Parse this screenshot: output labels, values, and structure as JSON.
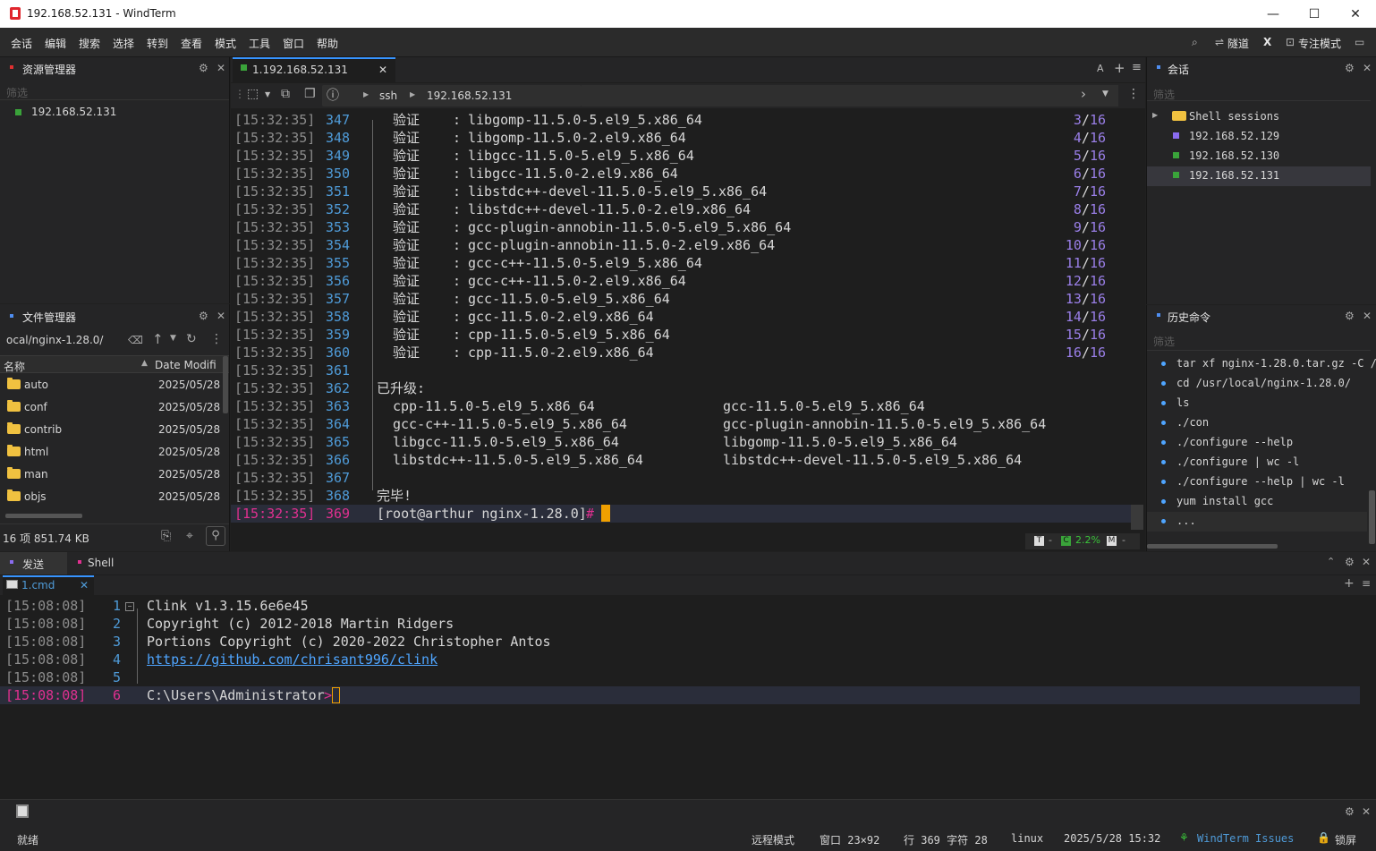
{
  "window": {
    "title": "192.168.52.131 - WindTerm",
    "minimize": "—",
    "maximize": "☐",
    "close": "✕"
  },
  "menu": [
    "会话",
    "编辑",
    "搜索",
    "选择",
    "转到",
    "查看",
    "模式",
    "工具",
    "窗口",
    "帮助"
  ],
  "toolbar_right": {
    "tunnel": "隧道",
    "x": "X",
    "focus": "专注模式"
  },
  "explorer": {
    "title": "资源管理器",
    "filter": "筛选",
    "item": "192.168.52.131"
  },
  "filemgr": {
    "title": "文件管理器",
    "path": "ocal/nginx-1.28.0/",
    "col_name": "名称",
    "col_date": "Date Modifi",
    "files": [
      {
        "name": "auto",
        "date": "2025/05/28"
      },
      {
        "name": "conf",
        "date": "2025/05/28"
      },
      {
        "name": "contrib",
        "date": "2025/05/28"
      },
      {
        "name": "html",
        "date": "2025/05/28"
      },
      {
        "name": "man",
        "date": "2025/05/28"
      },
      {
        "name": "objs",
        "date": "2025/05/28"
      }
    ],
    "footer": "16 项 851.74 KB"
  },
  "main_tab": {
    "label": "1.192.168.52.131",
    "close": "✕",
    "font_btn": "A",
    "add": "+",
    "more": "≡"
  },
  "addressbar": {
    "protocol": "ssh",
    "host": "192.168.52.131"
  },
  "terminal": {
    "verify": [
      {
        "ts": "[15:32:35]",
        "ln": "347",
        "pkg": "libgomp-11.5.0-5.el9_5.x86_64",
        "n": "3",
        "d": "16"
      },
      {
        "ts": "[15:32:35]",
        "ln": "348",
        "pkg": "libgomp-11.5.0-2.el9.x86_64",
        "n": "4",
        "d": "16"
      },
      {
        "ts": "[15:32:35]",
        "ln": "349",
        "pkg": "libgcc-11.5.0-5.el9_5.x86_64",
        "n": "5",
        "d": "16"
      },
      {
        "ts": "[15:32:35]",
        "ln": "350",
        "pkg": "libgcc-11.5.0-2.el9.x86_64",
        "n": "6",
        "d": "16"
      },
      {
        "ts": "[15:32:35]",
        "ln": "351",
        "pkg": "libstdc++-devel-11.5.0-5.el9_5.x86_64",
        "n": "7",
        "d": "16"
      },
      {
        "ts": "[15:32:35]",
        "ln": "352",
        "pkg": "libstdc++-devel-11.5.0-2.el9.x86_64",
        "n": "8",
        "d": "16"
      },
      {
        "ts": "[15:32:35]",
        "ln": "353",
        "pkg": "gcc-plugin-annobin-11.5.0-5.el9_5.x86_64",
        "n": "9",
        "d": "16"
      },
      {
        "ts": "[15:32:35]",
        "ln": "354",
        "pkg": "gcc-plugin-annobin-11.5.0-2.el9.x86_64",
        "n": "10",
        "d": "16"
      },
      {
        "ts": "[15:32:35]",
        "ln": "355",
        "pkg": "gcc-c++-11.5.0-5.el9_5.x86_64",
        "n": "11",
        "d": "16"
      },
      {
        "ts": "[15:32:35]",
        "ln": "356",
        "pkg": "gcc-c++-11.5.0-2.el9.x86_64",
        "n": "12",
        "d": "16"
      },
      {
        "ts": "[15:32:35]",
        "ln": "357",
        "pkg": "gcc-11.5.0-5.el9_5.x86_64",
        "n": "13",
        "d": "16"
      },
      {
        "ts": "[15:32:35]",
        "ln": "358",
        "pkg": "gcc-11.5.0-2.el9.x86_64",
        "n": "14",
        "d": "16"
      },
      {
        "ts": "[15:32:35]",
        "ln": "359",
        "pkg": "cpp-11.5.0-5.el9_5.x86_64",
        "n": "15",
        "d": "16"
      },
      {
        "ts": "[15:32:35]",
        "ln": "360",
        "pkg": "cpp-11.5.0-2.el9.x86_64",
        "n": "16",
        "d": "16"
      }
    ],
    "verify_word": "验证",
    "sep": ":",
    "blank1": {
      "ts": "[15:32:35]",
      "ln": "361"
    },
    "upgraded_line": {
      "ts": "[15:32:35]",
      "ln": "362",
      "text": "已升级:"
    },
    "upgraded": [
      {
        "ts": "[15:32:35]",
        "ln": "363",
        "a": "cpp-11.5.0-5.el9_5.x86_64",
        "b": "gcc-11.5.0-5.el9_5.x86_64"
      },
      {
        "ts": "[15:32:35]",
        "ln": "364",
        "a": "gcc-c++-11.5.0-5.el9_5.x86_64",
        "b": "gcc-plugin-annobin-11.5.0-5.el9_5.x86_64"
      },
      {
        "ts": "[15:32:35]",
        "ln": "365",
        "a": "libgcc-11.5.0-5.el9_5.x86_64",
        "b": "libgomp-11.5.0-5.el9_5.x86_64"
      },
      {
        "ts": "[15:32:35]",
        "ln": "366",
        "a": "libstdc++-11.5.0-5.el9_5.x86_64",
        "b": "libstdc++-devel-11.5.0-5.el9_5.x86_64"
      }
    ],
    "blank2": {
      "ts": "[15:32:35]",
      "ln": "367"
    },
    "done": {
      "ts": "[15:32:35]",
      "ln": "368",
      "text": "完毕!"
    },
    "prompt": {
      "ts": "[15:32:35]",
      "ln": "369",
      "text": "[root@arthur nginx-1.28.0]",
      "hash": "#"
    },
    "status": {
      "t": "T",
      "dash1": "-",
      "c": "C",
      "pct": "2.2%",
      "m": "M",
      "dash2": "-"
    }
  },
  "sessions": {
    "title": "会话",
    "filter": "筛选",
    "group": "Shell sessions",
    "items": [
      "192.168.52.129",
      "192.168.52.130",
      "192.168.52.131"
    ],
    "item_colors": [
      "#8a6cf0",
      "#3aa33a",
      "#3aa33a"
    ]
  },
  "history": {
    "title": "历史命令",
    "filter": "筛选",
    "items": [
      "tar xf nginx-1.28.0.tar.gz -C /",
      "cd /usr/local/nginx-1.28.0/",
      "ls",
      "./con",
      "./configure --help",
      "./configure | wc -l",
      "./configure --help | wc -l",
      "yum install gcc",
      "..."
    ]
  },
  "bottom": {
    "tab_send": "发送",
    "tab_shell": "Shell",
    "cmd_tab": "1.cmd",
    "cmd_close": "✕",
    "lines": [
      {
        "ts": "[15:08:08]",
        "ln": "1",
        "text": "Clink v1.3.15.6e6e45"
      },
      {
        "ts": "[15:08:08]",
        "ln": "2",
        "text": "Copyright (c) 2012-2018 Martin Ridgers"
      },
      {
        "ts": "[15:08:08]",
        "ln": "3",
        "text": "Portions Copyright (c) 2020-2022 Christopher Antos"
      },
      {
        "ts": "[15:08:08]",
        "ln": "4",
        "text": "https://github.com/chrisant996/clink"
      },
      {
        "ts": "[15:08:08]",
        "ln": "5",
        "text": ""
      }
    ],
    "prompt": {
      "ts": "[15:08:08]",
      "ln": "6",
      "text": "C:\\Users\\Administrator",
      "gt": ">"
    }
  },
  "statusbar": {
    "ready": "就绪",
    "mode": "远程模式",
    "window": "窗口 23×92",
    "pos": "行 369 字符 28",
    "os": "linux",
    "datetime": "2025/5/28 15:32",
    "issues": "WindTerm Issues",
    "lock": "锁屏"
  }
}
